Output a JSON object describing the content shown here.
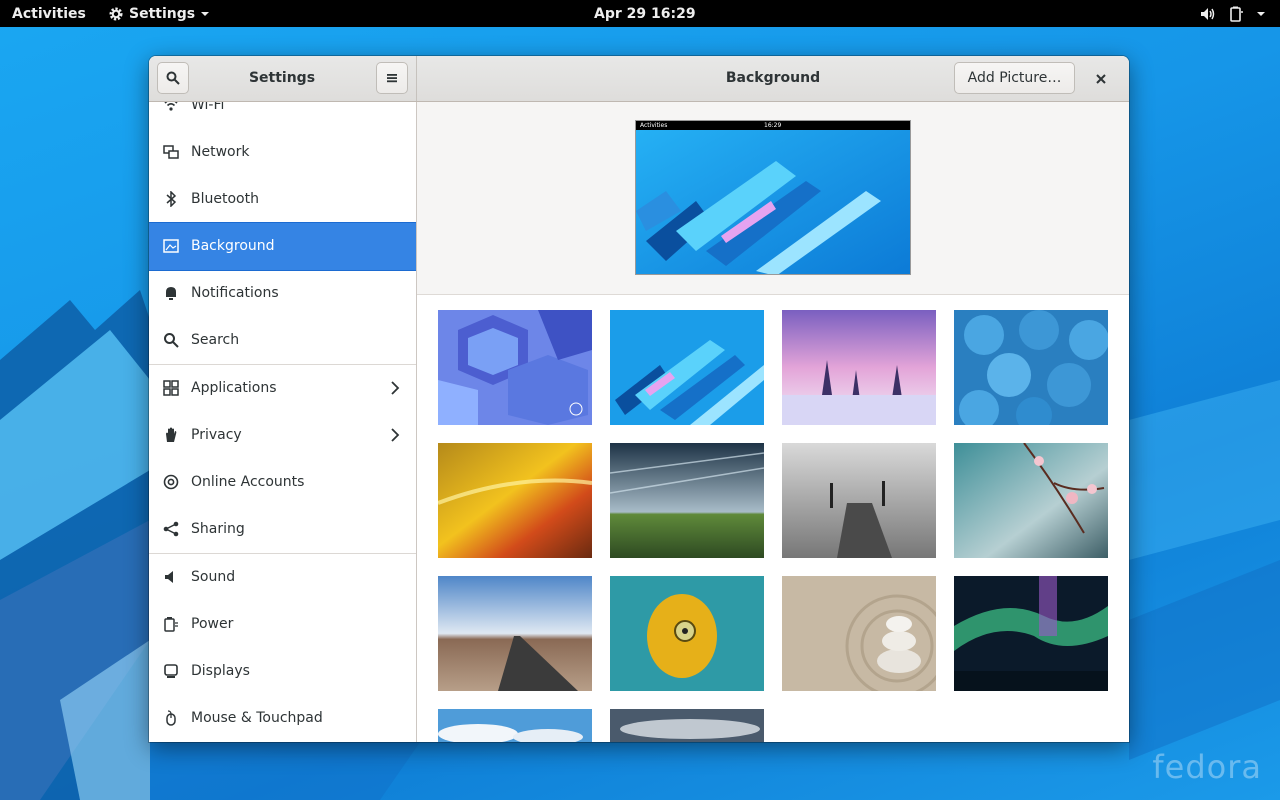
{
  "topbar": {
    "activities": "Activities",
    "app_menu": "Settings",
    "clock": "Apr 29  16:29"
  },
  "window": {
    "sidebar_title": "Settings",
    "page_title": "Background",
    "add_picture": "Add Picture…"
  },
  "sidebar": {
    "items": [
      {
        "label": "Wi-Fi",
        "icon": "wifi-icon"
      },
      {
        "label": "Network",
        "icon": "network-icon"
      },
      {
        "label": "Bluetooth",
        "icon": "bluetooth-icon"
      },
      {
        "label": "Background",
        "icon": "background-icon",
        "active": true
      },
      {
        "label": "Notifications",
        "icon": "bell-icon"
      },
      {
        "label": "Search",
        "icon": "search-icon"
      },
      {
        "label": "Applications",
        "icon": "applications-icon",
        "has_submenu": true
      },
      {
        "label": "Privacy",
        "icon": "hand-icon",
        "has_submenu": true
      },
      {
        "label": "Online Accounts",
        "icon": "at-icon"
      },
      {
        "label": "Sharing",
        "icon": "share-icon"
      },
      {
        "label": "Sound",
        "icon": "speaker-icon"
      },
      {
        "label": "Power",
        "icon": "power-plug-icon"
      },
      {
        "label": "Displays",
        "icon": "display-icon"
      },
      {
        "label": "Mouse & Touchpad",
        "icon": "mouse-icon"
      }
    ]
  },
  "preview": {
    "bar_left": "Activities",
    "bar_clock": "16:29"
  },
  "wallpapers": [
    {
      "name": "blue-hexagons",
      "selected": true
    },
    {
      "name": "blue-diagonal-shards"
    },
    {
      "name": "snowy-trees-sunset"
    },
    {
      "name": "blue-plastic-pieces"
    },
    {
      "name": "woven-fabric-closeup"
    },
    {
      "name": "green-field-clouds"
    },
    {
      "name": "foggy-pier"
    },
    {
      "name": "cherry-blossom-branch"
    },
    {
      "name": "desert-road"
    },
    {
      "name": "yellow-frog"
    },
    {
      "name": "zen-stones-sand"
    },
    {
      "name": "aurora-borealis"
    },
    {
      "name": "blue-sky-partial"
    },
    {
      "name": "cloudy-sky-partial"
    }
  ],
  "desktop": {
    "watermark": "fedora"
  },
  "colors": {
    "accent": "#3584e4",
    "topbar": "#000000",
    "desktop": "#1d8ee6"
  }
}
